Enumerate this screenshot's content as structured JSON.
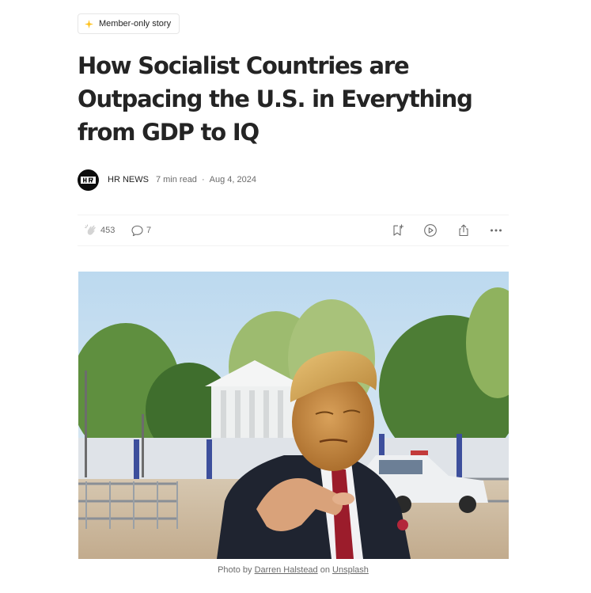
{
  "badge": {
    "label": "Member-only story",
    "icon": "sparkle-icon",
    "icon_color": "#FFC017"
  },
  "article": {
    "title": "How Socialist Countries are Outpacing the U.S. in Everything from GDP to IQ",
    "author": "HR NEWS",
    "read_time": "7 min read",
    "separator": "·",
    "date": "Aug 4, 2024"
  },
  "actions": {
    "clap_count": "453",
    "comment_count": "7",
    "icons": [
      "clap-icon",
      "comment-icon",
      "bookmark-add-icon",
      "listen-icon",
      "share-icon",
      "more-icon"
    ]
  },
  "caption": {
    "prefix": "Photo by ",
    "photographer": "Darren Halstead",
    "middle": " on ",
    "source": "Unsplash"
  },
  "colors": {
    "text": "#242424",
    "muted": "#6b6b6b",
    "border": "#f2f2f2"
  }
}
